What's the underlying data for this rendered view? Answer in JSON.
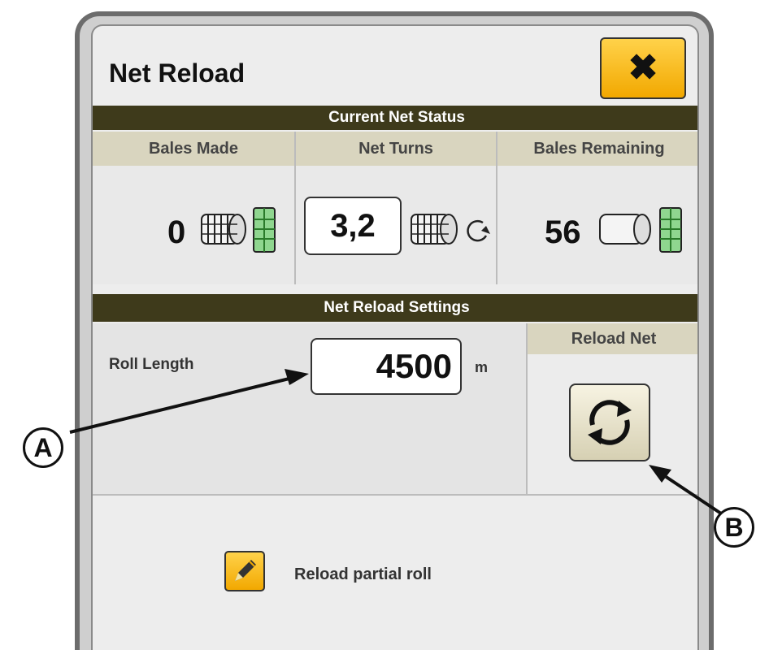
{
  "dialog": {
    "title": "Net Reload",
    "close_icon": "close-x-icon",
    "accent": "#f2a800"
  },
  "net_status": {
    "header": "Current Net Status",
    "columns": [
      {
        "label": "Bales Made",
        "value": "0",
        "icon": "netted-bale-icon"
      },
      {
        "label": "Net Turns",
        "value": "3,2",
        "icon": "net-turns-icon"
      },
      {
        "label": "Bales Remaining",
        "value": "56",
        "icon": "bale-remaining-icon"
      }
    ]
  },
  "settings": {
    "header": "Net Reload Settings",
    "roll_length_label": "Roll Length",
    "roll_length_value": "4500",
    "roll_length_unit": "m",
    "reload_header": "Reload Net",
    "reload_icon": "reload-cycle-icon"
  },
  "partial": {
    "label": "Reload partial roll",
    "icon": "pencil-icon"
  },
  "callouts": {
    "a": "A",
    "b": "B"
  },
  "colors": {
    "header_bar": "#3e3a1b",
    "column_header": "#d9d5bf",
    "button_yellow": "#f2a800"
  }
}
